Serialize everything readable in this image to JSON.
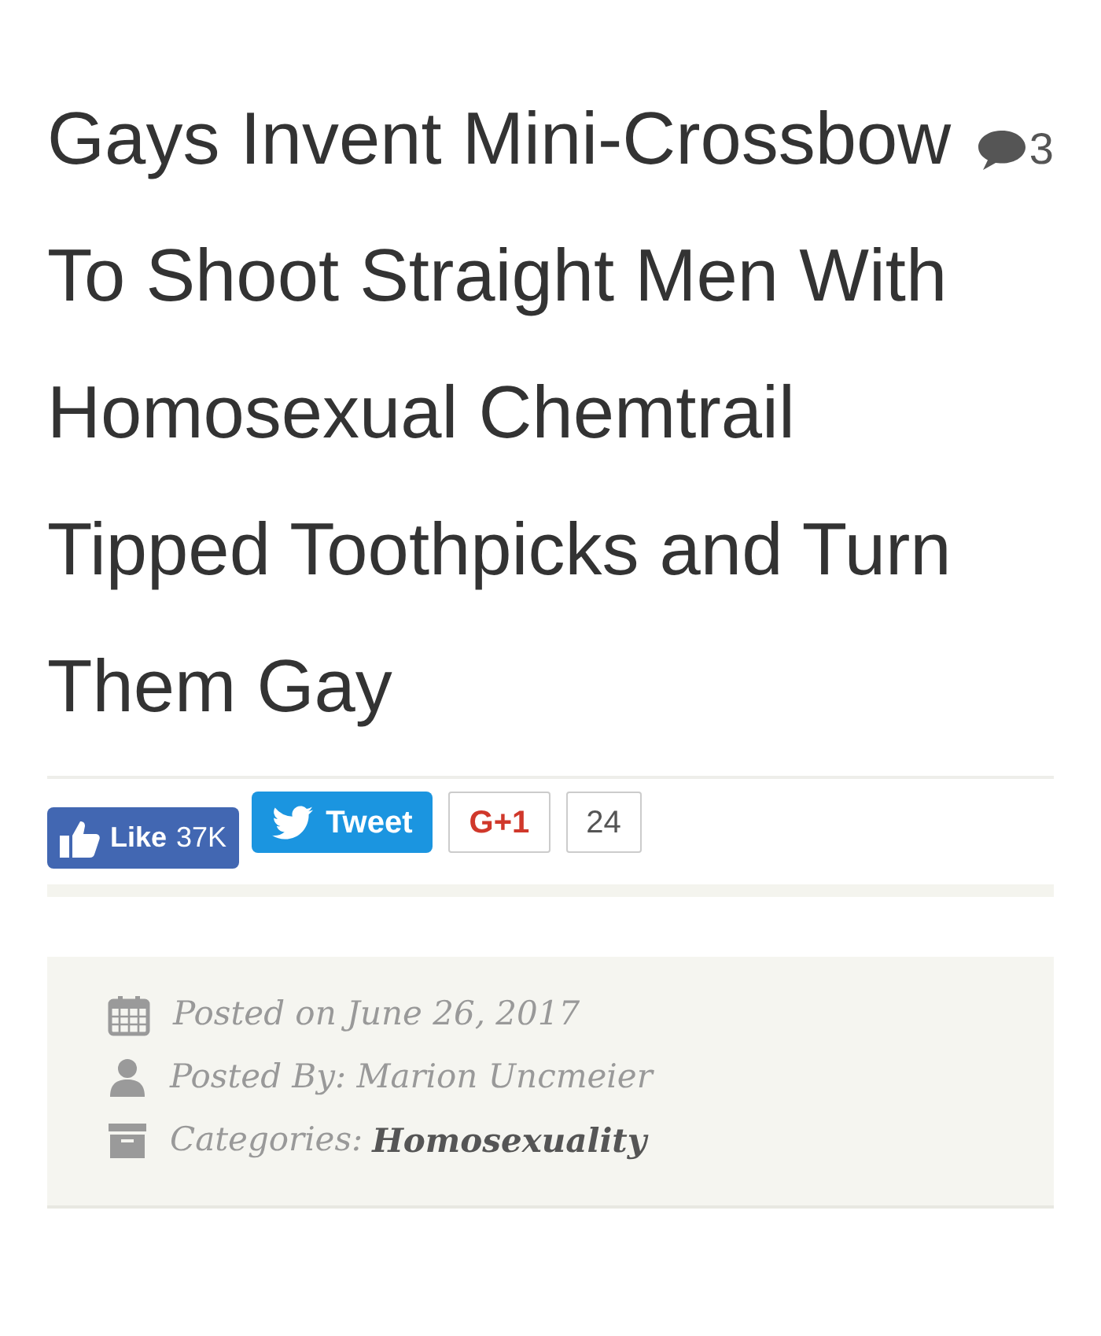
{
  "article": {
    "title": "Gays Invent Mini-Crossbow To Shoot Straight Men With Homosexual Chemtrail Tipped Toothpicks and Turn Them Gay",
    "comment_count": "3"
  },
  "share_bar": {
    "like": {
      "label": "Like",
      "count": "37K"
    },
    "tweet": {
      "label": "Tweet"
    },
    "gplus": {
      "label": "G+1",
      "count": "24"
    }
  },
  "meta": [
    {
      "kind": "date",
      "text": "Posted on June 26, 2017"
    },
    {
      "kind": "author",
      "text": "Posted By: Marion Uncmeier"
    },
    {
      "kind": "category",
      "text": "Categories:",
      "link": "Homosexuality"
    }
  ]
}
